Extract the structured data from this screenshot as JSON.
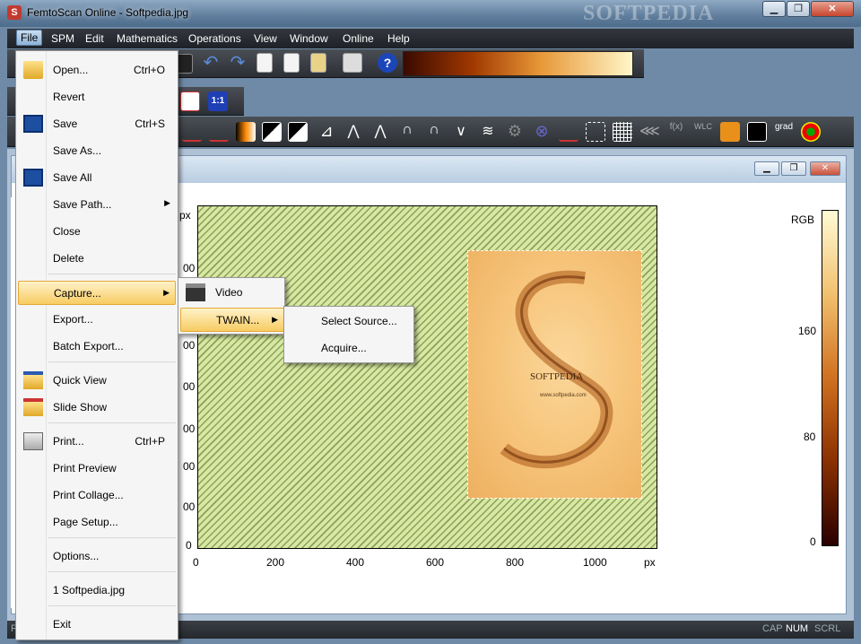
{
  "window": {
    "title": "FemtoScan Online - Softpedia.jpg",
    "icon": "S",
    "watermark": "SOFTPEDIA"
  },
  "window_controls": {
    "minimize": "▁",
    "maximize": "❐",
    "close": "✕"
  },
  "menubar": [
    "File",
    "SPM",
    "Edit",
    "Mathematics",
    "Operations",
    "View",
    "Window",
    "Online",
    "Help"
  ],
  "file_menu": [
    {
      "label": "Open...",
      "shortcut": "Ctrl+O",
      "icon": "folder-open-icon"
    },
    {
      "label": "Revert",
      "shortcut": ""
    },
    {
      "label": "Save",
      "shortcut": "Ctrl+S",
      "icon": "floppy-icon"
    },
    {
      "label": "Save As...",
      "shortcut": ""
    },
    {
      "label": "Save All",
      "shortcut": "",
      "icon": "floppy-multi-icon"
    },
    {
      "label": "Save Path...",
      "shortcut": "",
      "submenu": true
    },
    {
      "label": "Close",
      "shortcut": ""
    },
    {
      "label": "Delete",
      "shortcut": ""
    },
    {
      "label": "Capture...",
      "shortcut": "",
      "submenu": true,
      "highlighted": true
    },
    {
      "label": "Export...",
      "shortcut": ""
    },
    {
      "label": "Batch Export...",
      "shortcut": ""
    },
    {
      "label": "Quick View",
      "shortcut": "",
      "icon": "folder-view-icon"
    },
    {
      "label": "Slide Show",
      "shortcut": "",
      "icon": "folder-slideshow-icon"
    },
    {
      "label": "Print...",
      "shortcut": "Ctrl+P",
      "icon": "printer-icon"
    },
    {
      "label": "Print Preview",
      "shortcut": ""
    },
    {
      "label": "Print Collage...",
      "shortcut": ""
    },
    {
      "label": "Page Setup...",
      "shortcut": ""
    },
    {
      "label": "Options...",
      "shortcut": ""
    },
    {
      "label": "1 Softpedia.jpg",
      "shortcut": ""
    },
    {
      "label": "Exit",
      "shortcut": ""
    }
  ],
  "capture_submenu": [
    {
      "label": "Video",
      "icon": "clapperboard-icon"
    },
    {
      "label": "TWAIN...",
      "submenu": true,
      "highlighted": true
    }
  ],
  "twain_submenu": [
    {
      "label": "Select Source..."
    },
    {
      "label": "Acquire..."
    }
  ],
  "child_controls": {
    "minimize": "▁",
    "maximize": "❐",
    "close": "✕"
  },
  "plot": {
    "x_unit": "px",
    "y_unit": "px",
    "x_ticks": [
      "0",
      "200",
      "400",
      "600",
      "800",
      "1000"
    ],
    "y_ticks": [
      "0",
      "00",
      "00",
      "00",
      "00",
      "00",
      "00",
      "00"
    ],
    "image_text": "SOFTPEDIA",
    "image_url": "www.softpedia.com",
    "colorbar_label": "RGB",
    "colorbar_ticks": [
      "0",
      "80",
      "160"
    ]
  },
  "toolbar": {
    "zoom_label": "1:1",
    "help_label": "?",
    "grad_label": "grad"
  },
  "colors": {
    "accent": "#f7cc63",
    "menubar": "#1e2227",
    "colormap_dark": "#3a0a00",
    "colormap_light": "#fff6c8"
  },
  "statusbar": {
    "left": "R",
    "cap": "CAP",
    "num": "NUM",
    "scrl": "SCRL"
  }
}
